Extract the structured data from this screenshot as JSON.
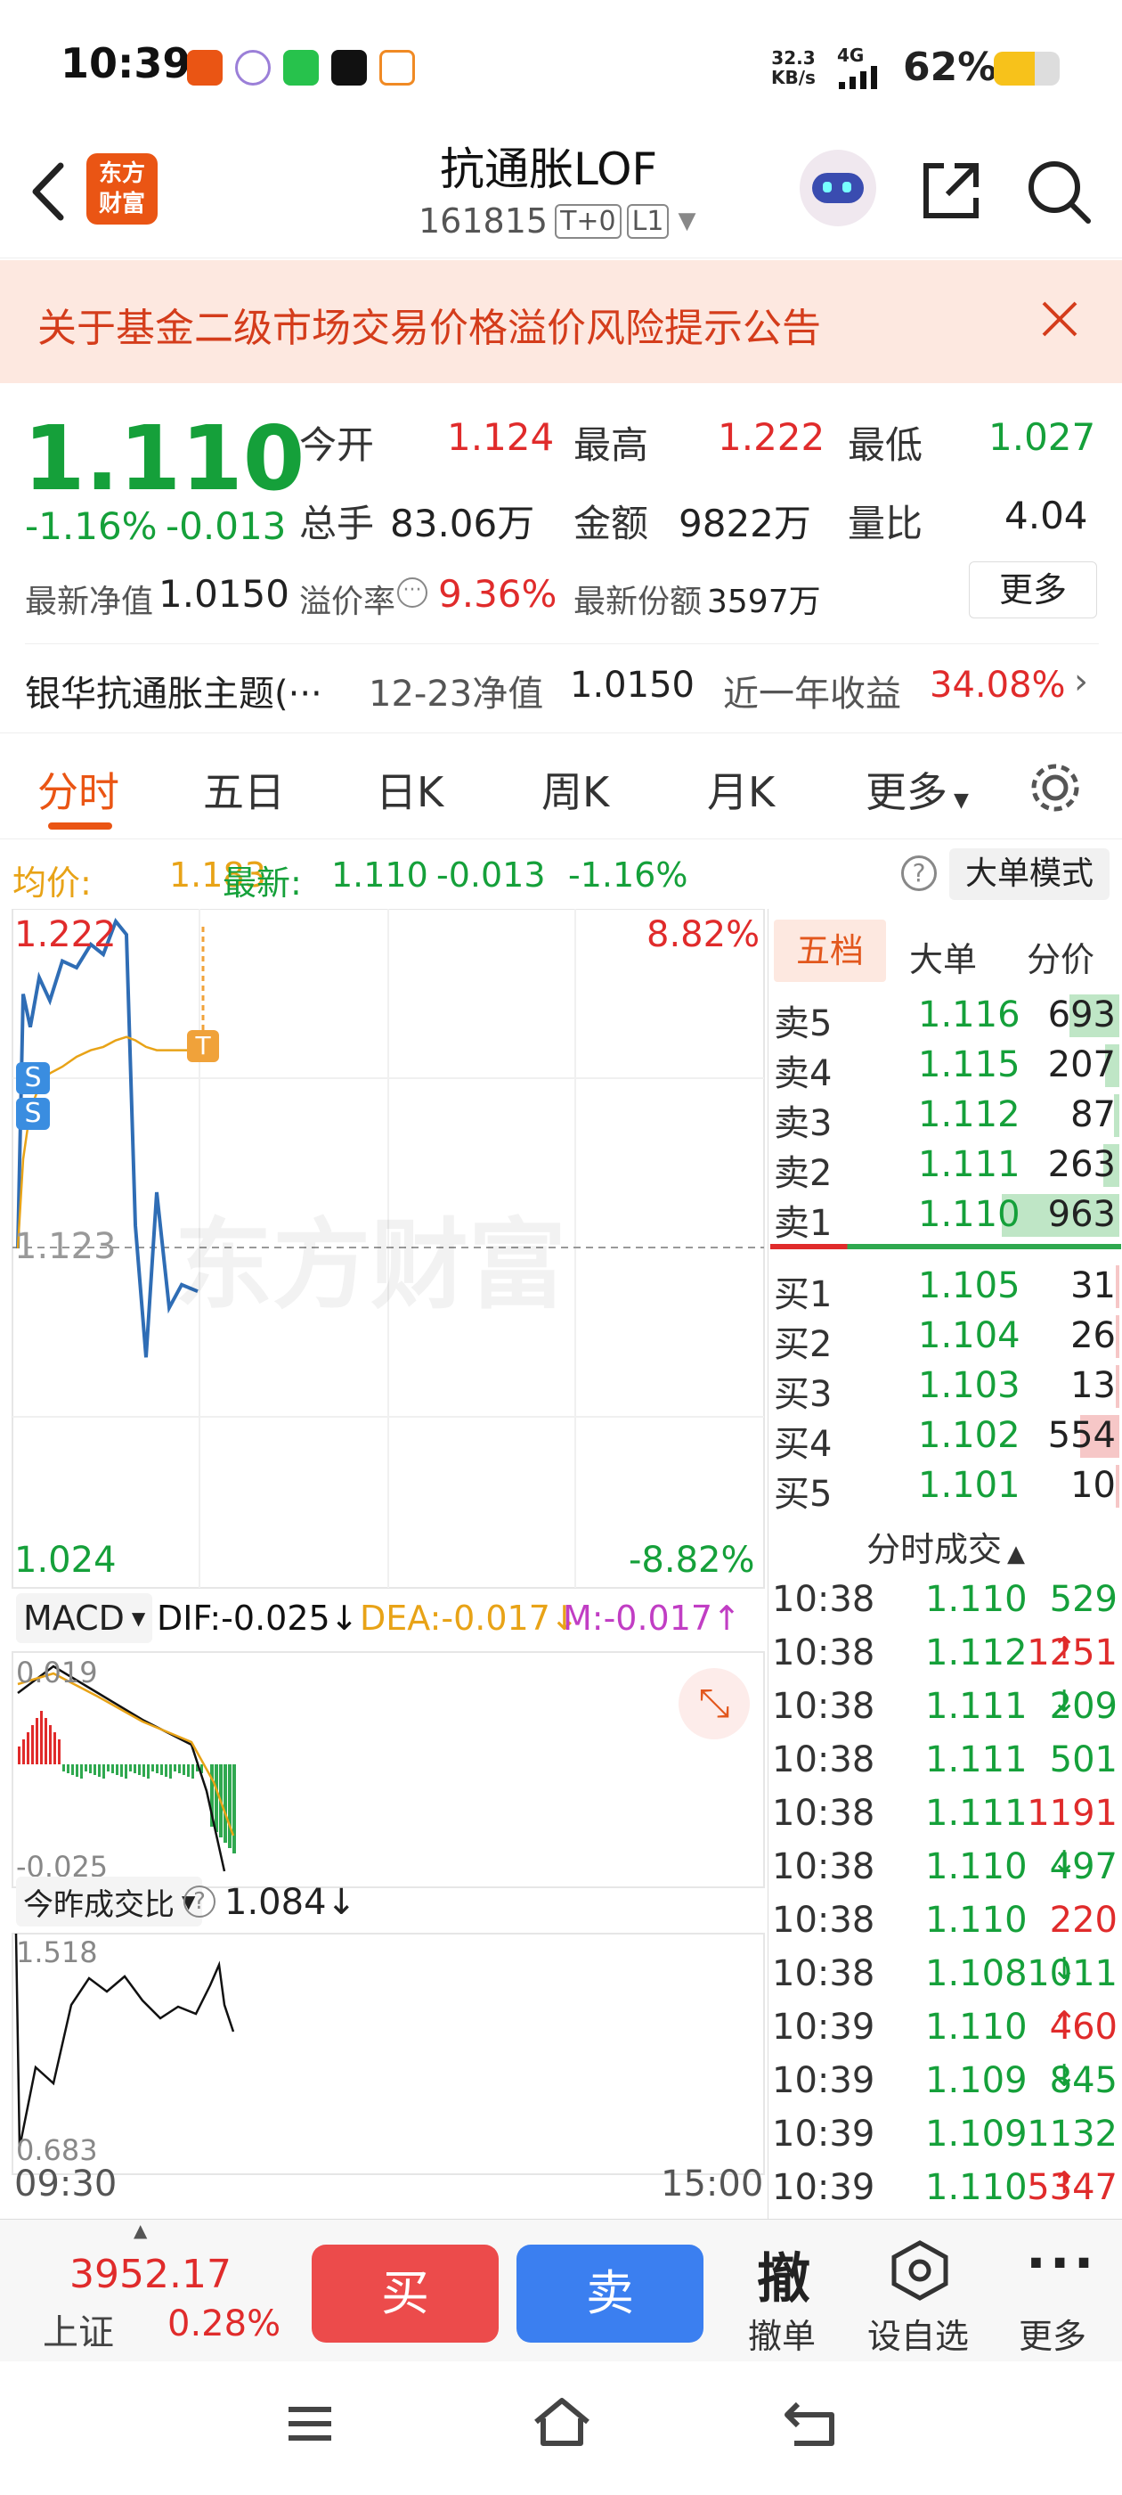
{
  "status_bar": {
    "time": "10:39",
    "net_speed_top": "32.3",
    "net_speed_unit": "KB/s",
    "network": "4G",
    "battery": "62%"
  },
  "header": {
    "back_icon": "chevron-left-icon",
    "logo_line1": "东方",
    "logo_line2": "财富",
    "title": "抗通胀LOF",
    "code": "161815",
    "badge_t0": "T+0",
    "badge_l1": "L1"
  },
  "notice": {
    "text": "关于基金二级市场交易价格溢价风险提示公告"
  },
  "quote": {
    "price": "1.110",
    "change_pct": "-1.16%",
    "change": "-0.013",
    "open_label": "今开",
    "open": "1.124",
    "high_label": "最高",
    "high": "1.222",
    "low_label": "最低",
    "low": "1.027",
    "volume_label": "总手",
    "volume": "83.06万",
    "amount_label": "金额",
    "amount": "9822万",
    "ratio_label": "量比",
    "ratio": "4.04",
    "nav_label": "最新净值",
    "nav": "1.0150",
    "premium_label": "溢价率",
    "premium": "9.36%",
    "shares_label": "最新份额",
    "shares": "3597万",
    "more": "更多"
  },
  "fund_info": {
    "name": "银华抗通胀主题(···",
    "nav_date_label": "12-23净值",
    "nav": "1.0150",
    "year_label": "近一年收益",
    "year_return": "34.08%"
  },
  "tabs": [
    "分时",
    "五日",
    "日K",
    "周K",
    "月K",
    "更多"
  ],
  "avg_line": {
    "avg_label": "均价:",
    "avg": "1.183",
    "latest_label": "最新:",
    "latest": "1.110",
    "chg": "-0.013",
    "chg_pct": "-1.16%",
    "mode_button": "大单模式"
  },
  "chart": {
    "y_high": "1.222",
    "y_high_pct": "8.82%",
    "y_mid": "1.123",
    "y_low": "1.024",
    "y_low_pct": "-8.82%",
    "watermark": "东方财富",
    "marker_s": "S",
    "marker_t": "T",
    "macd_select": "MACD",
    "dif": "DIF:-0.025↓",
    "dea": "DEA:-0.017↓",
    "m": "M:-0.017↑",
    "macd_top": "0.019",
    "macd_bottom": "-0.025",
    "vr_select": "今昨成交比",
    "vr_value": "1.084↓",
    "vr_top": "1.518",
    "vr_bottom": "0.683",
    "time_start": "09:30",
    "time_end": "15:00"
  },
  "chart_data": {
    "type": "line",
    "title": "",
    "y_range": [
      1.024,
      1.222
    ],
    "y_reference": 1.123,
    "series": [
      {
        "name": "最新",
        "values": [
          1.123,
          1.2,
          1.19,
          1.205,
          1.198,
          1.21,
          1.208,
          1.215,
          1.212,
          1.222,
          1.218,
          1.13,
          1.09,
          1.14,
          1.105,
          1.112,
          1.11
        ]
      },
      {
        "name": "均价",
        "values": [
          1.123,
          1.15,
          1.165,
          1.172,
          1.176,
          1.178,
          1.181,
          1.183,
          1.184,
          1.186,
          1.187,
          1.186,
          1.184,
          1.183,
          1.183,
          1.183,
          1.183
        ]
      }
    ]
  },
  "order_book": {
    "tabs": [
      "五档",
      "大单",
      "分价"
    ],
    "asks": [
      {
        "name": "卖5",
        "price": "1.116",
        "vol": "693",
        "frac": 0.28
      },
      {
        "name": "卖4",
        "price": "1.115",
        "vol": "207",
        "frac": 0.08
      },
      {
        "name": "卖3",
        "price": "1.112",
        "vol": "87",
        "frac": 0.03
      },
      {
        "name": "卖2",
        "price": "1.111",
        "vol": "263",
        "frac": 0.09
      },
      {
        "name": "卖1",
        "price": "1.110",
        "vol": "963",
        "frac": 0.66
      }
    ],
    "bids": [
      {
        "name": "买1",
        "price": "1.105",
        "vol": "31",
        "frac": 0.01
      },
      {
        "name": "买2",
        "price": "1.104",
        "vol": "26",
        "frac": 0.01
      },
      {
        "name": "买3",
        "price": "1.103",
        "vol": "13",
        "frac": 0.01
      },
      {
        "name": "买4",
        "price": "1.102",
        "vol": "554",
        "frac": 0.22
      },
      {
        "name": "买5",
        "price": "1.101",
        "vol": "10",
        "frac": 0.01
      }
    ],
    "ticks_title": "分时成交",
    "ticks": [
      {
        "time": "10:38",
        "price": "1.110",
        "arrow": "",
        "vol": "529",
        "color": "green"
      },
      {
        "time": "10:38",
        "price": "1.112",
        "arrow": "↑",
        "vol": "1251",
        "color": "red"
      },
      {
        "time": "10:38",
        "price": "1.111",
        "arrow": "↓",
        "vol": "209",
        "color": "green"
      },
      {
        "time": "10:38",
        "price": "1.111",
        "arrow": "",
        "vol": "501",
        "color": "green"
      },
      {
        "time": "10:38",
        "price": "1.111",
        "arrow": "",
        "vol": "1191",
        "color": "red"
      },
      {
        "time": "10:38",
        "price": "1.110",
        "arrow": "↓",
        "vol": "497",
        "color": "green"
      },
      {
        "time": "10:38",
        "price": "1.110",
        "arrow": "",
        "vol": "220",
        "color": "red"
      },
      {
        "time": "10:38",
        "price": "1.108",
        "arrow": "↓",
        "vol": "1011",
        "color": "green"
      },
      {
        "time": "10:39",
        "price": "1.110",
        "arrow": "↑",
        "vol": "460",
        "color": "red"
      },
      {
        "time": "10:39",
        "price": "1.109",
        "arrow": "↓",
        "vol": "845",
        "color": "green"
      },
      {
        "time": "10:39",
        "price": "1.109",
        "arrow": "",
        "vol": "1132",
        "color": "green"
      },
      {
        "time": "10:39",
        "price": "1.110",
        "arrow": "↑",
        "vol": "5347",
        "color": "red"
      }
    ]
  },
  "trade_bar": {
    "index_value": "3952.17",
    "index_name": "上证",
    "index_pct": "0.28%",
    "buy": "买",
    "sell": "卖",
    "cancel_glyph": "撤",
    "cancel": "撤单",
    "watch": "设自选",
    "more": "更多"
  }
}
